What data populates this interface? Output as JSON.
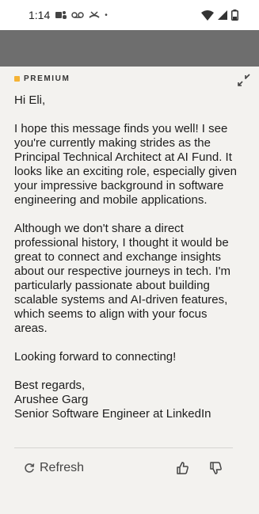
{
  "status_bar": {
    "time": "1:14"
  },
  "header": {
    "premium_label": "PREMIUM",
    "accent_color": "#f5b335"
  },
  "message": {
    "greeting": "Hi Eli,",
    "paragraph_1": "I hope this message finds you well! I see you're currently making strides as the Principal Technical Architect at AI Fund. It looks like an exciting role, especially given your impressive background in software engineering and mobile applications.",
    "paragraph_2": "Although we don't share a direct professional history, I thought it would be great to connect and exchange insights about our respective journeys in tech. I'm particularly passionate about building scalable systems and AI-driven features, which seems to align with your focus areas.",
    "paragraph_3": "Looking forward to connecting!",
    "signoff": "Best regards,",
    "name": "Arushee Garg",
    "title": "Senior Software Engineer at LinkedIn"
  },
  "actions": {
    "refresh_label": "Refresh"
  }
}
